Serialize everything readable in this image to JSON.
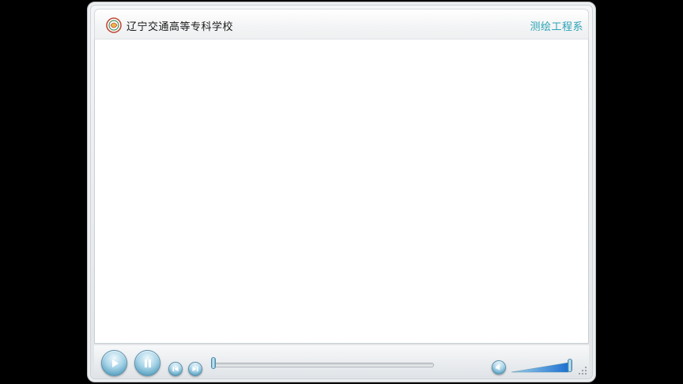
{
  "header": {
    "school_name": "辽宁交通高等专科学校",
    "department": "测绘工程系"
  },
  "icons": {
    "logo": "school-logo-icon",
    "play": "play-icon",
    "pause": "pause-icon",
    "previous": "previous-icon",
    "next": "next-icon",
    "volume": "speaker-icon"
  },
  "playback": {
    "progress_fraction": 0.0,
    "volume_fraction": 1.0
  },
  "colors": {
    "accent_text": "#2ba3b6",
    "button_blue": "#5ea4c4"
  }
}
